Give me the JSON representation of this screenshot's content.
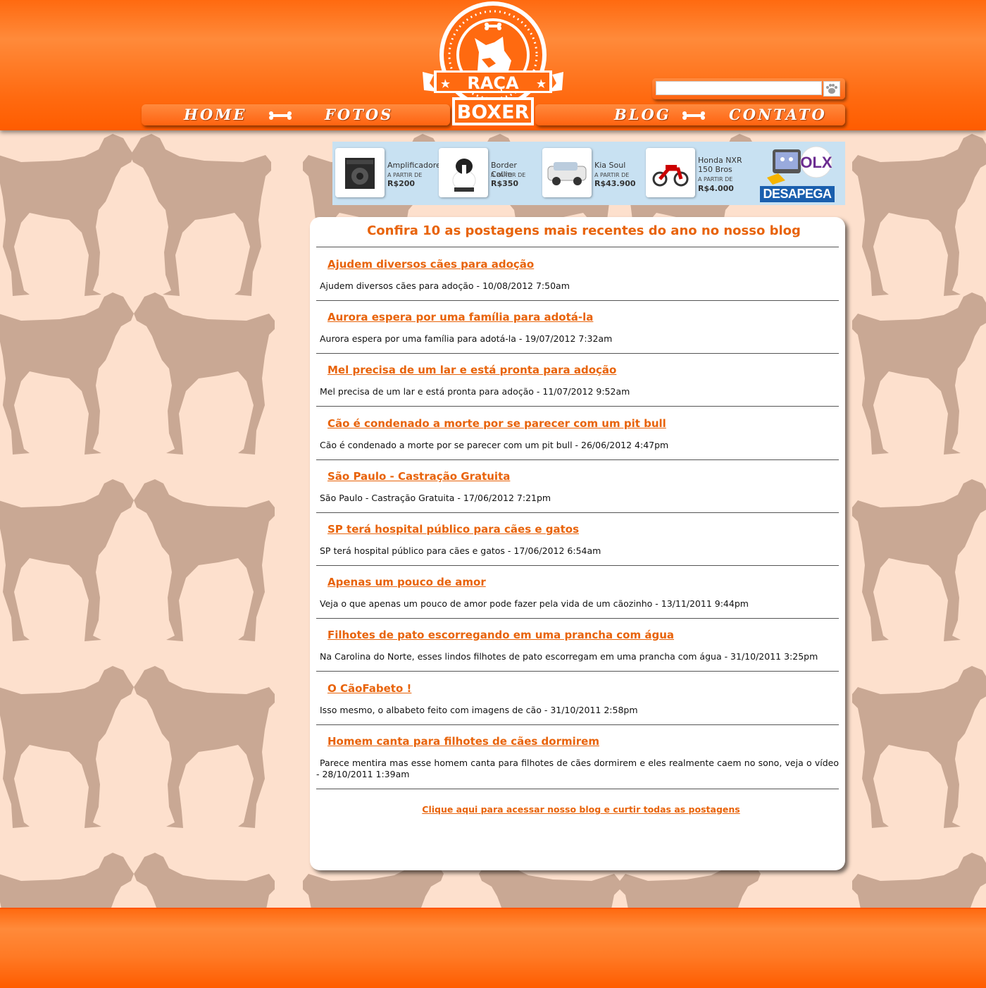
{
  "brand": {
    "line1": "RAÇA",
    "line2": "BOXER"
  },
  "nav": {
    "home": "HOME",
    "photos": "FOTOS",
    "blog": "BLOG",
    "contact": "CONTATO"
  },
  "search": {
    "value": "",
    "placeholder": ""
  },
  "ad": {
    "items": [
      {
        "name": "Amplificadore",
        "from": "A PARTIR DE",
        "price": "R$200"
      },
      {
        "name": "Border Collie",
        "from": "A PARTIR DE",
        "price": "R$350"
      },
      {
        "name": "Kia Soul",
        "from": "A PARTIR DE",
        "price": "R$43.900"
      },
      {
        "name": "Honda NXR 150 Bros",
        "from": "A PARTIR DE",
        "price": "R$4.000"
      }
    ],
    "brand": "OLX",
    "slogan": "DESAPEGA"
  },
  "main": {
    "title": "Confira 10 as postagens mais recentes do ano no nosso blog",
    "posts": [
      {
        "title": "Ajudem diversos cães para adoção",
        "desc": "Ajudem diversos cães para adoção - 10/08/2012 7:50am"
      },
      {
        "title": "Aurora espera por uma família para adotá-la",
        "desc": "Aurora espera por uma família para adotá-la - 19/07/2012 7:32am"
      },
      {
        "title": "Mel precisa de um lar e está pronta para adoção",
        "desc": "Mel precisa de um lar e está pronta para adoção - 11/07/2012 9:52am"
      },
      {
        "title": "Cão é condenado a morte por se parecer com um pit bull",
        "desc": "Cão é condenado a morte por se parecer com um pit bull - 26/06/2012 4:47pm"
      },
      {
        "title": "São Paulo - Castração Gratuita",
        "desc": "São Paulo - Castração Gratuita - 17/06/2012 7:21pm"
      },
      {
        "title": "SP terá hospital público para cães e gatos",
        "desc": "SP terá hospital público para cães e gatos - 17/06/2012 6:54am"
      },
      {
        "title": "Apenas um pouco de amor",
        "desc": "Veja o que apenas um pouco de amor pode fazer pela vida de um cãozinho - 13/11/2011 9:44pm"
      },
      {
        "title": "Filhotes de pato escorregando em uma prancha com água",
        "desc": "Na Carolina do Norte, esses lindos filhotes de pato escorregam em uma prancha com água - 31/10/2011 3:25pm"
      },
      {
        "title": "O CãoFabeto !",
        "desc": "Isso mesmo, o albabeto feito com imagens de cão - 31/10/2011 2:58pm"
      },
      {
        "title": "Homem canta para filhotes de cães dormirem",
        "desc": "Parece mentira mas esse homem canta para filhotes de cães dormirem e eles realmente caem no sono, veja o vídeo - 28/10/2011 1:39am"
      }
    ],
    "blog_link": "Clique aqui para acessar nosso blog e curtir todas as postagens"
  },
  "colors": {
    "accent": "#e8630a",
    "header": "#ff6a10",
    "background": "#fde0cd",
    "silhouette": "#c9a894",
    "ad_background": "#c8e1f2"
  }
}
